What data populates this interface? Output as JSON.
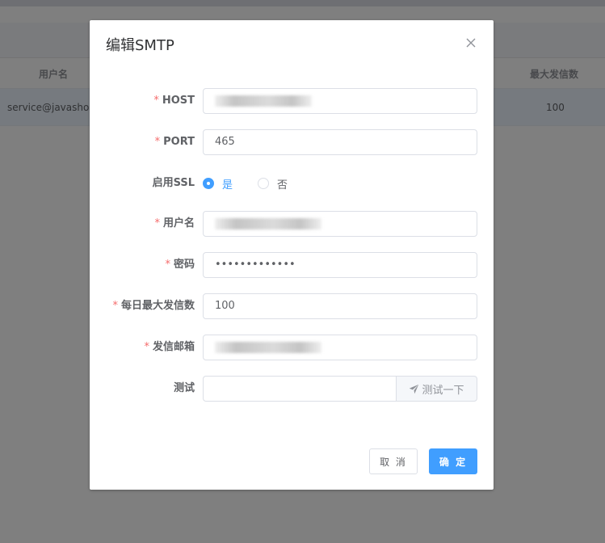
{
  "background": {
    "table": {
      "headers": {
        "username": "用户名",
        "max_daily": "最大发信数"
      },
      "row": {
        "username": "service@javashop.",
        "max_daily": "100"
      }
    }
  },
  "dialog": {
    "title": "编辑SMTP",
    "close_icon": "close-icon",
    "fields": {
      "host": {
        "label": "HOST",
        "value": ""
      },
      "port": {
        "label": "PORT",
        "value": "465"
      },
      "ssl": {
        "label": "启用SSL",
        "options": [
          "是",
          "否"
        ],
        "selected": "是"
      },
      "username": {
        "label": "用户名",
        "value": ""
      },
      "password": {
        "label": "密码",
        "value": "•••••••••••••"
      },
      "max_daily": {
        "label": "每日最大发信数",
        "value": "100"
      },
      "from_email": {
        "label": "发信邮箱",
        "value": ""
      },
      "test": {
        "label": "测试",
        "value": "",
        "button_label": "测试一下",
        "button_icon": "paper-plane-icon"
      }
    },
    "buttons": {
      "cancel": "取 消",
      "confirm": "确 定"
    }
  },
  "colors": {
    "primary": "#409eff",
    "required": "#f56c6c"
  }
}
